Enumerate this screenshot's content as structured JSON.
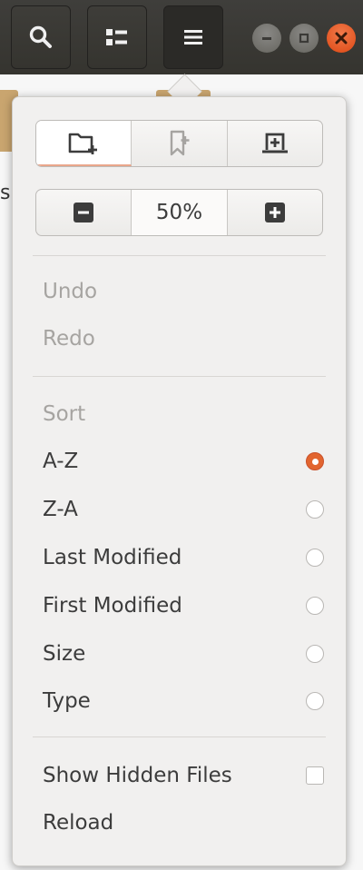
{
  "zoom": {
    "level": "50%"
  },
  "menu": {
    "undo": "Undo",
    "redo": "Redo",
    "sort_header": "Sort",
    "sort_options": [
      {
        "label": "A-Z",
        "selected": true
      },
      {
        "label": "Z-A",
        "selected": false
      },
      {
        "label": "Last Modified",
        "selected": false
      },
      {
        "label": "First Modified",
        "selected": false
      },
      {
        "label": "Size",
        "selected": false
      },
      {
        "label": "Type",
        "selected": false
      }
    ],
    "show_hidden": "Show Hidden Files",
    "show_hidden_checked": false,
    "reload": "Reload"
  },
  "background": {
    "partial_text": "s"
  },
  "colors": {
    "accent": "#e2652f",
    "close_button": "#dd4814",
    "headerbar": "#3a3935"
  },
  "icons": {
    "header": [
      "search-icon",
      "view-list-icon",
      "hamburger-menu-icon"
    ],
    "window_controls": [
      "minimize-icon",
      "maximize-icon",
      "close-icon"
    ],
    "new_items": [
      "new-folder-icon",
      "bookmark-add-icon",
      "new-tab-icon"
    ],
    "zoom": [
      "zoom-out-icon",
      "zoom-in-icon"
    ]
  }
}
